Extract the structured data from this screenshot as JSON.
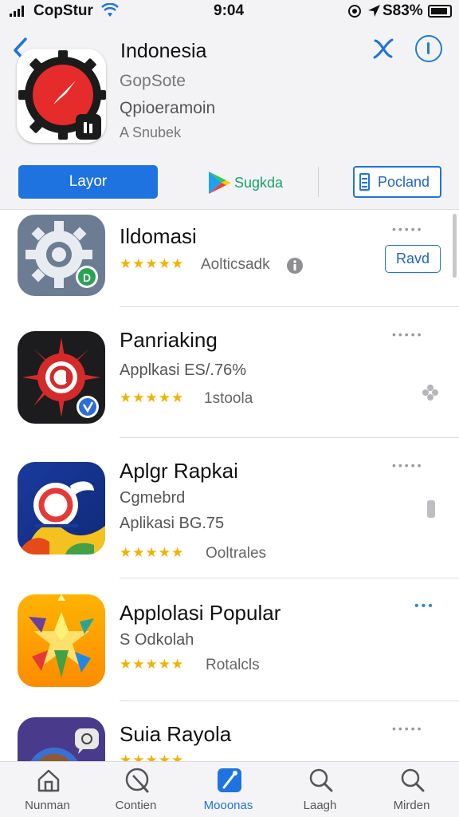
{
  "status_bar": {
    "carrier": "CopStur",
    "time": "9:04",
    "battery": "S83%"
  },
  "header": {
    "title": "Indonesia",
    "subtitle_1": "GopSote",
    "subtitle_2": "Qpioeramoin",
    "subtitle_3": "A Snubek",
    "primary_button": "Layor",
    "play_label": "Sugkda",
    "secondary_button": "Pocland"
  },
  "apps": [
    {
      "name": "Ildomasi",
      "meta": "Aolticsadk",
      "action": "Ravd",
      "stars": "★★★★★"
    },
    {
      "name": "Panriaking",
      "line": "Applkasi ES/.76%",
      "meta": "1stoola",
      "stars": "★★★★★"
    },
    {
      "name": "Aplgr Rapkai",
      "line": "Cgmebrd",
      "line2": "Aplikasi BG.75",
      "meta": "Ooltrales",
      "stars": "★★★★★"
    },
    {
      "name": "Applolasi Popular",
      "line": "S Odkolah",
      "meta": "Rotalcls",
      "stars": "★★★★★"
    },
    {
      "name": "Suia Rayola",
      "stars": "★★★★★"
    }
  ],
  "tabs": [
    {
      "label": "Nunman",
      "icon": "home-icon"
    },
    {
      "label": "Contien",
      "icon": "compass-icon"
    },
    {
      "label": "Mooonas",
      "icon": "apps-icon",
      "active": true
    },
    {
      "label": "Laagh",
      "icon": "search-icon"
    },
    {
      "label": "Mirden",
      "icon": "search-icon"
    }
  ],
  "colors": {
    "accent": "#1f73e0",
    "star": "#f2b200",
    "play_green": "#17a56d"
  }
}
